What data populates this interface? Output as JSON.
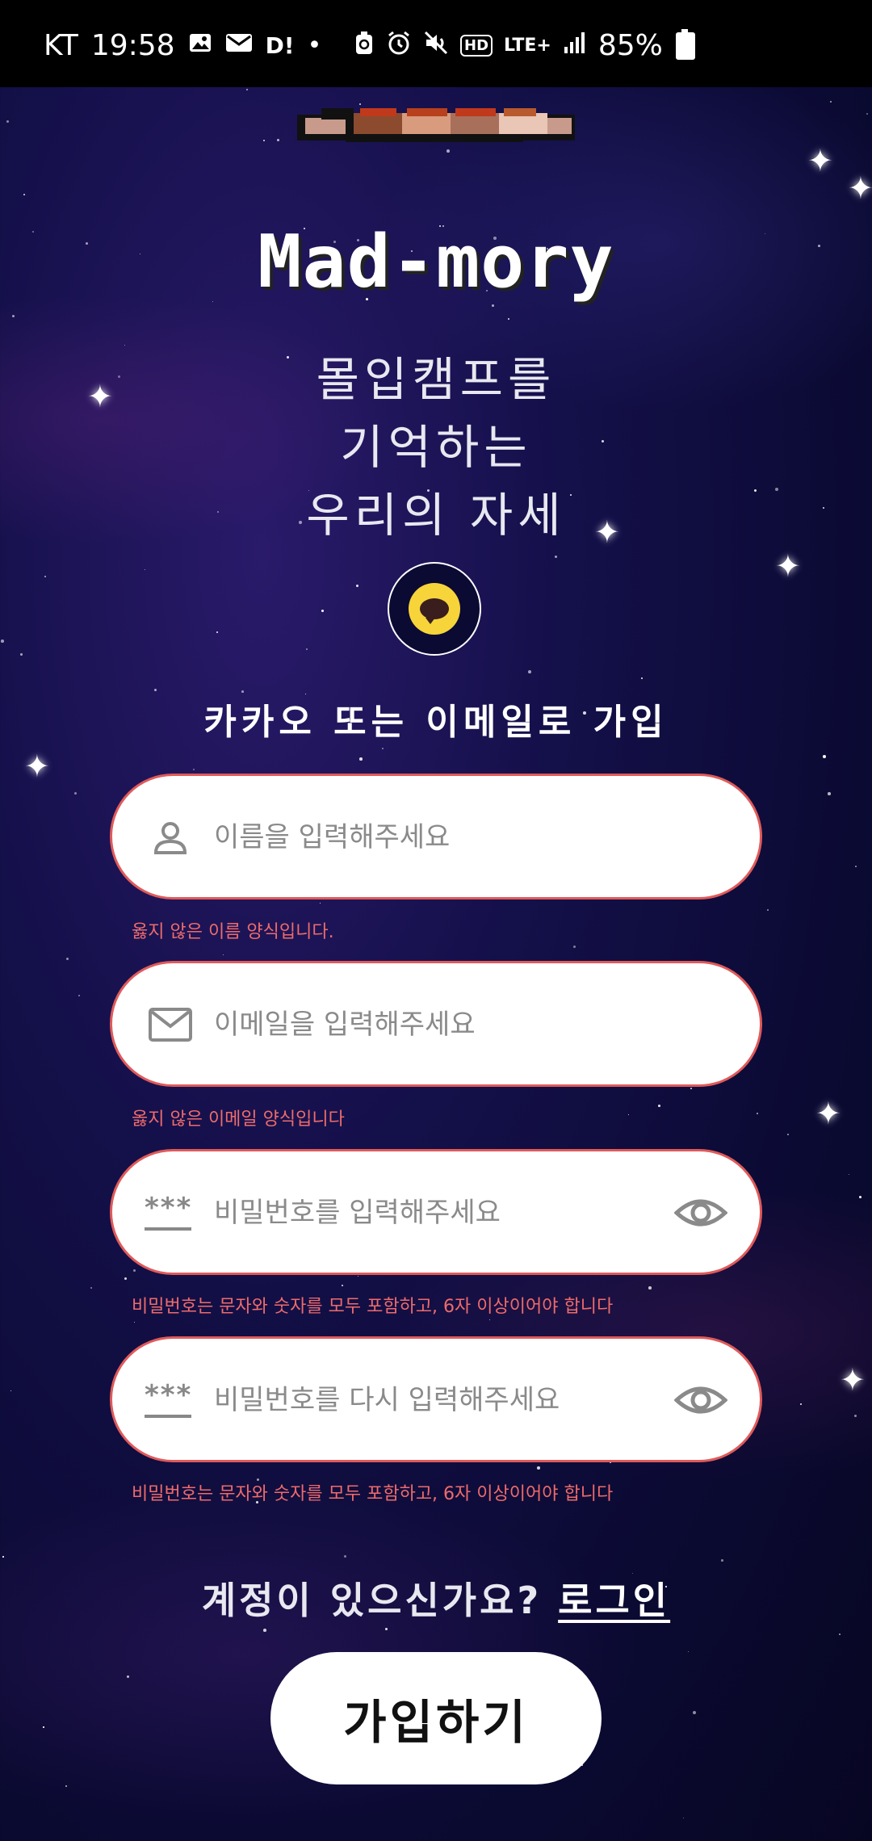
{
  "status_bar": {
    "carrier": "KT",
    "time": "19:58",
    "left_icons": [
      "gallery-icon",
      "mail-icon",
      "d-icon",
      "dot-icon"
    ],
    "d_label": "D!",
    "right_icons": [
      "recycle-icon",
      "alarm-icon",
      "mute-icon",
      "hd-icon",
      "lte-icon",
      "signal-icon"
    ],
    "hd_label": "HD",
    "lte_label": "LTE+",
    "battery_percent": "85%"
  },
  "app": {
    "title": "Mad-mory",
    "subtitle_lines": [
      "몰입캠프를",
      "기억하는",
      "우리의 자세"
    ]
  },
  "kakao": {
    "icon": "kakao-talk-icon",
    "signup_label": "카카오 또는 이메일로 가입"
  },
  "form": {
    "name": {
      "placeholder": "이름을 입력해주세요",
      "value": "",
      "icon": "person-icon",
      "error": "옳지 않은 이름 양식입니다."
    },
    "email": {
      "placeholder": "이메일을 입력해주세요",
      "value": "",
      "icon": "mail-icon",
      "error": "옳지 않은 이메일 양식입니다"
    },
    "password": {
      "placeholder": "비밀번호를 입력해주세요",
      "value": "",
      "icon": "password-icon",
      "icon_text": "***",
      "toggle_icon": "eye-icon",
      "error": "비밀번호는 문자와 숫자를 모두 포함하고, 6자 이상이어야 합니다"
    },
    "password_confirm": {
      "placeholder": "비밀번호를 다시 입력해주세요",
      "value": "",
      "icon": "password-icon",
      "icon_text": "***",
      "toggle_icon": "eye-icon",
      "error": "비밀번호는 문자와 숫자를 모두 포함하고, 6자 이상이어야 합니다"
    }
  },
  "login_prompt": {
    "text": "계정이 있으신가요?",
    "link": "로그인"
  },
  "submit": {
    "label": "가입하기"
  },
  "colors": {
    "background": "#0b0a33",
    "field_border": "#e05a5a",
    "error_text": "#ef6b6b",
    "kakao_yellow": "#f7d43a"
  }
}
